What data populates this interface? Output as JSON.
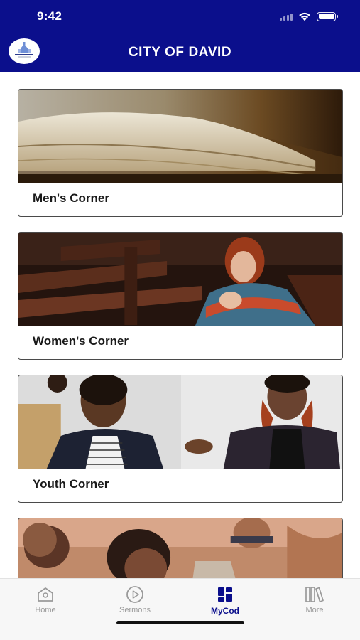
{
  "status": {
    "time": "9:42"
  },
  "header": {
    "title": "CITY OF DAVID",
    "logo_text": "CITY OF DAVID"
  },
  "cards": [
    {
      "label": "Men's Corner"
    },
    {
      "label": "Women's Corner"
    },
    {
      "label": "Youth Corner"
    },
    {
      "label": ""
    }
  ],
  "tabs": [
    {
      "label": "Home",
      "icon": "home-icon",
      "active": false
    },
    {
      "label": "Sermons",
      "icon": "play-icon",
      "active": false
    },
    {
      "label": "MyCod",
      "icon": "dashboard-icon",
      "active": true
    },
    {
      "label": "More",
      "icon": "library-icon",
      "active": false
    }
  ],
  "colors": {
    "brand": "#0b0f8c",
    "tab_inactive": "#9a9a9a"
  }
}
